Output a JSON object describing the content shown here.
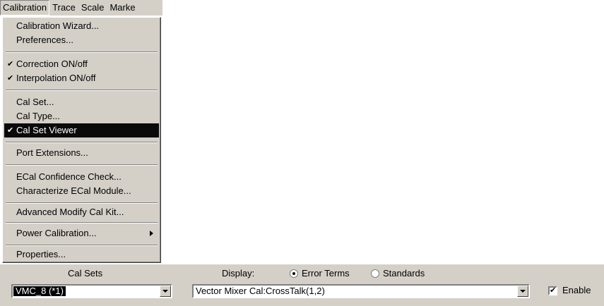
{
  "menubar": {
    "items": [
      {
        "label": "Calibration",
        "active": true
      },
      {
        "label": "Trace"
      },
      {
        "label": "Scale"
      },
      {
        "label": "Marke"
      }
    ]
  },
  "dropdown": {
    "items": [
      {
        "label": "Calibration Wizard..."
      },
      {
        "label": "Preferences..."
      },
      {
        "label": "Correction ON/off",
        "checked": true
      },
      {
        "label": "Interpolation ON/off",
        "checked": true
      },
      {
        "label": "Cal Set..."
      },
      {
        "label": "Cal Type..."
      },
      {
        "label": "Cal Set Viewer",
        "checked": true,
        "highlighted": true
      },
      {
        "label": "Port Extensions..."
      },
      {
        "label": "ECal Confidence Check..."
      },
      {
        "label": "Characterize ECal Module..."
      },
      {
        "label": "Advanced Modify Cal Kit..."
      },
      {
        "label": "Power Calibration...",
        "submenu": true
      },
      {
        "label": "Properties..."
      }
    ]
  },
  "toolbar": {
    "cal_sets_label": "Cal Sets",
    "cal_set_value": "VMC_8 (*1)",
    "display_label": "Display:",
    "radio_error_terms": "Error Terms",
    "radio_standards": "Standards",
    "display_selected": "Error Terms",
    "term_value": "Vector Mixer Cal:CrossTalk(1,2)",
    "enable_label": "Enable",
    "enable_checked": true
  }
}
